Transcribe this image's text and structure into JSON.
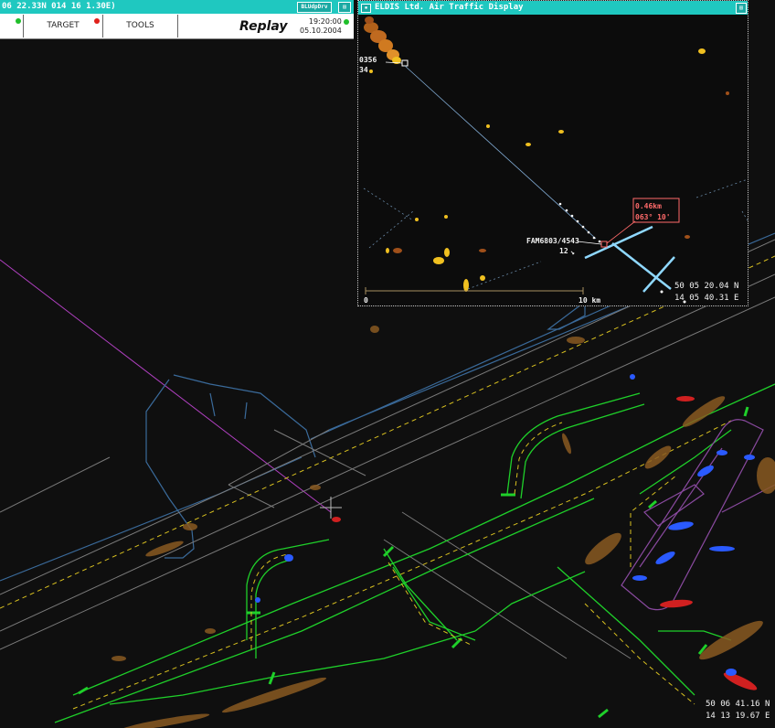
{
  "control_window": {
    "title": "06 22.33N 014 16 1.30E)",
    "sys_button": "BLUdpDrv",
    "target_label": "TARGET",
    "tools_label": "TOOLS",
    "mode_label": "Replay",
    "time": "19:20:00",
    "date": "05.10.2004",
    "status_colors": {
      "ok": "#1fbf2a",
      "alert": "#e0201a"
    }
  },
  "inset_window": {
    "title": "ELDIS Ltd. Air Traffic Display",
    "track_a": {
      "id": "0356",
      "level": "34"
    },
    "track_b": {
      "callsign": "FAM6803/4543",
      "level": "12"
    },
    "range_bearing": {
      "distance": "0.46km",
      "bearing": "063° 10'"
    },
    "scale": {
      "start": "0",
      "end": "10 km"
    },
    "coord_lat": "50 05 20.04 N",
    "coord_lon": "14 05 40.31 E"
  },
  "main_display": {
    "coord_lat": "50 06 41.16 N",
    "coord_lon": "14 13 19.67 E"
  },
  "colors": {
    "taxiway_green": "#1fd02a",
    "taxi_centerline": "#d8c020",
    "runway_grey": "#7a7a7a",
    "outline_blue": "#3a6a9a",
    "clutter_brown": "#8a5a22",
    "target_blue": "#2a5aff",
    "target_red": "#d02020",
    "extended_centerline": "#b040c0",
    "titlebar": "#1fc8c0"
  }
}
